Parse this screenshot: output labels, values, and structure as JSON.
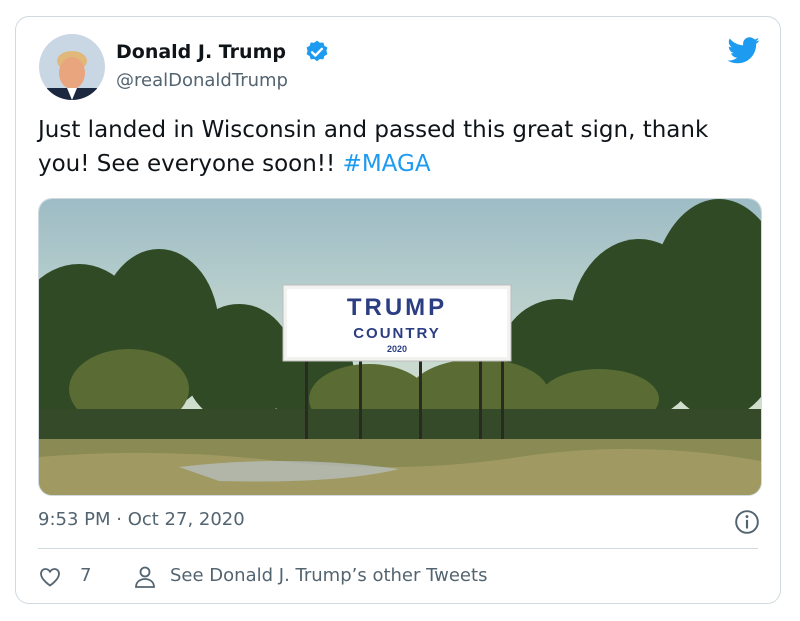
{
  "author": {
    "name": "Donald J. Trump",
    "handle": "@realDonaldTrump",
    "verified": true
  },
  "tweet": {
    "text": "Just landed in Wisconsin and passed this great sign, thank you! See everyone soon!! ",
    "hashtag": "#MAGA"
  },
  "photo": {
    "sign_line1": "TRUMP",
    "sign_line2": "COUNTRY",
    "sign_line3": "2020"
  },
  "meta": {
    "timestamp": "9:53 PM · Oct 27, 2020"
  },
  "actions": {
    "like_count": "7",
    "other_tweets_label": "See Donald J. Trump’s other Tweets"
  },
  "colors": {
    "accent": "#1d9bf0",
    "secondary_text": "#536471",
    "border": "#cfd9de",
    "sign_blue": "#2c3e82"
  },
  "icons": [
    "verified-badge-icon",
    "twitter-bird-icon",
    "info-icon",
    "heart-icon",
    "person-icon"
  ]
}
